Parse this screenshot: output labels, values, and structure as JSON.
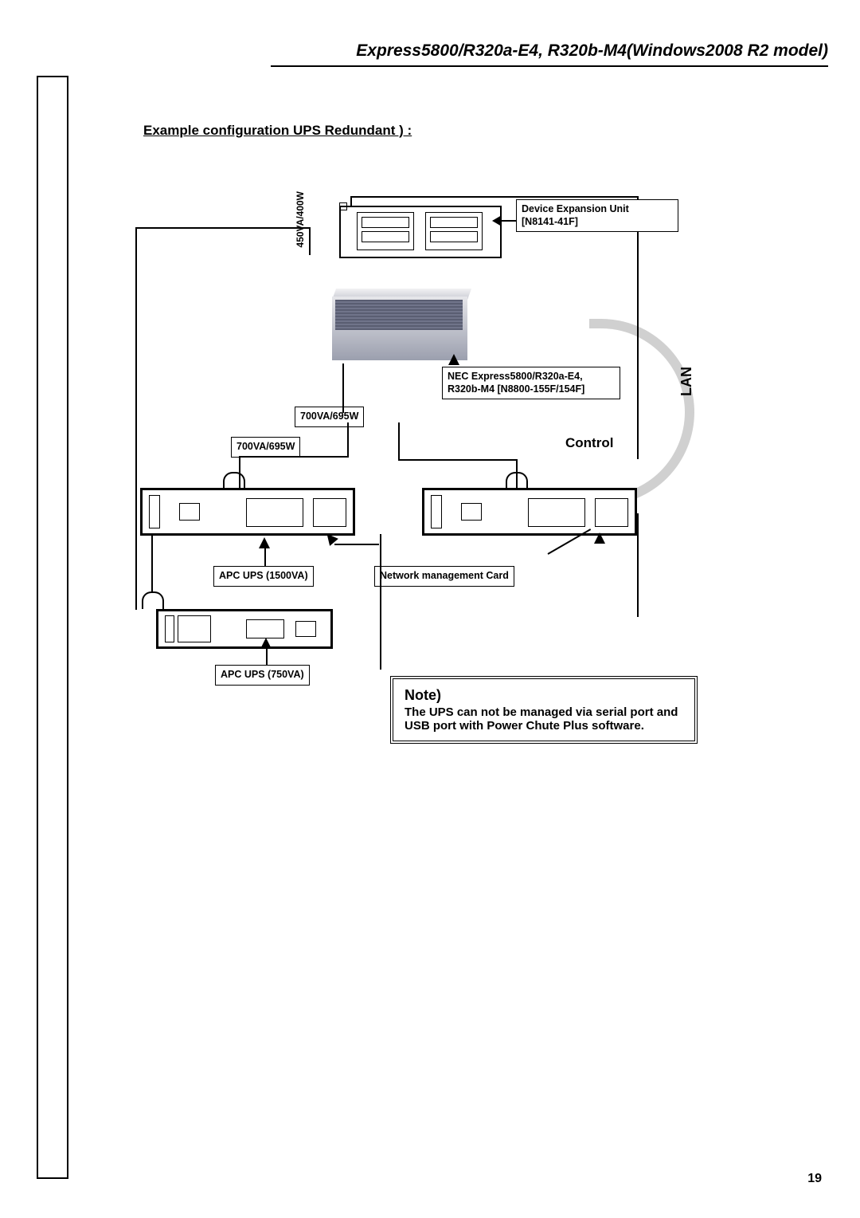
{
  "header_title": "Express5800/R320a-E4, R320b-M4(Windows2008 R2 model)",
  "page_number": "19",
  "section_title": "Example configuration UPS Redundant ) :",
  "labels": {
    "va450": "450VA/400W",
    "va700a": "700VA/695W",
    "va700b": "700VA/695W",
    "dev_expansion_l1": "Device Expansion Unit",
    "dev_expansion_l2": "[N8141-41F]",
    "server_l1": "NEC Express5800/R320a-E4,",
    "server_l2": "R320b-M4 [N8800-155F/154F]",
    "control": "Control",
    "lan": "LAN",
    "apc1500": "APC UPS (1500VA)",
    "network_card": "Network management Card",
    "apc750": "APC UPS (750VA)"
  },
  "note": {
    "title": "Note)",
    "body": "The UPS can not be managed via serial port and USB port with Power Chute Plus software."
  }
}
